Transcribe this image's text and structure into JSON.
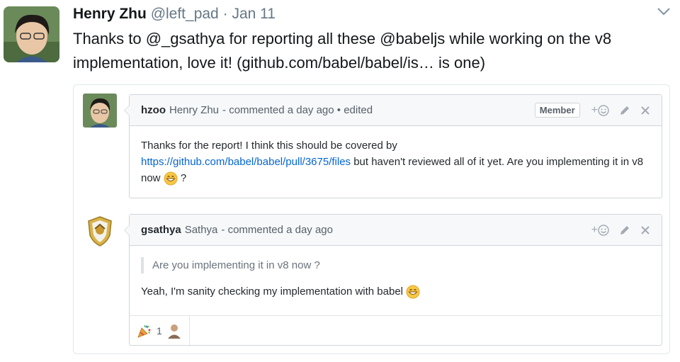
{
  "tweet": {
    "name": "Henry Zhu",
    "handle": "@left_pad",
    "separator": "·",
    "date": "Jan 11",
    "text": "Thanks to @_gsathya for reporting all these @babeljs while working on the v8 implementation, love it! (github.com/babel/babel/is… is one)"
  },
  "comments": [
    {
      "login": "hzoo",
      "fullname": "Henry Zhu",
      "meta": "- commented a day ago • edited",
      "badge": "Member",
      "add_reaction": "+",
      "body_before_link": "Thanks for the report! I think this should be covered by",
      "link": "https://github.com/babel/babel/pull/3675/files",
      "body_after_link": " but haven't reviewed all of it yet. Are you implementing it in v8 now",
      "body_end": " ?"
    },
    {
      "login": "gsathya",
      "fullname": "Sathya",
      "meta": "- commented a day ago",
      "add_reaction": "+",
      "quote": "Are you implementing it in v8 now ?",
      "body": "Yeah, I'm sanity checking my implementation with babel",
      "reaction_count": "1"
    }
  ],
  "icons": [
    "chevron-down-icon",
    "smiley-icon",
    "pencil-icon",
    "close-icon",
    "grinning-emoji",
    "tada-emoji",
    "shield-avatar"
  ],
  "colors": {
    "link": "#0366d6",
    "handle": "#657786",
    "border": "#d1d5da",
    "header_bg": "#f6f8fa"
  }
}
